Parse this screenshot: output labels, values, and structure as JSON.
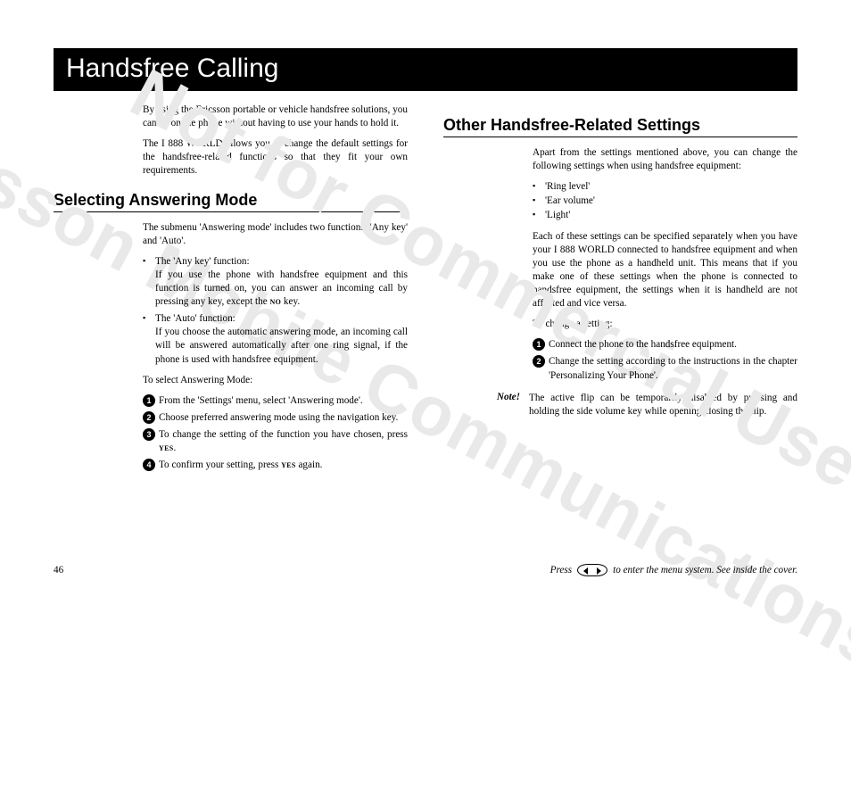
{
  "watermark": {
    "line1": "Not for Commercial Use",
    "line2": "Ericsson Mobile Communications AB"
  },
  "title": "Handsfree Calling",
  "left": {
    "intro1": "By using the Ericsson portable or vehicle handsfree solutions, you can be on the phone without having to use your hands to hold it.",
    "intro2": "The I 888 WORLD allows you to change the default settings for the handsfree-related functions so that they fit your own requirements.",
    "h2": "Selecting Answering Mode",
    "p1": "The submenu 'Answering mode' includes two functions:  'Any key' and 'Auto'.",
    "bul1a": "The 'Any key' function:",
    "bul1b_pre": "If you use the phone with handsfree equipment and this function is turned on, you can answer an incoming call by pressing any key, except the ",
    "bul1b_key": "no",
    "bul1b_post": " key.",
    "bul2a": "The 'Auto' function:",
    "bul2b": "If you choose the automatic answering mode, an incoming call will be answered automatically after one ring signal, if the phone is used with handsfree equipment.",
    "p2": "To select Answering Mode:",
    "step1": "From the 'Settings' menu, select 'Answering mode'.",
    "step2": "Choose preferred answering mode using the navigation key.",
    "step3_pre": "To change the setting of the function you have chosen, press ",
    "step3_key": "yes",
    "step3_post": ".",
    "step4_pre": "To confirm your setting, press ",
    "step4_key": "yes",
    "step4_post": " again."
  },
  "right": {
    "h2": "Other Handsfree-Related Settings",
    "p1": "Apart from the settings mentioned above, you can change the following settings when using handsfree equipment:",
    "items": {
      "a": "'Ring level'",
      "b": "'Ear volume'",
      "c": "'Light'"
    },
    "p2": "Each of these settings can be specified separately when you have your I 888 WORLD connected to handsfree equipment and when you use the phone as a handheld unit. This means that if you make one of these settings when the phone is connected to handsfree equipment, the settings when it is handheld are not affected and vice versa.",
    "p3": "To change a setting:",
    "step1": "Connect the phone to the handsfree equipment.",
    "step2": "Change the setting according to the instructions in the chapter 'Personalizing Your Phone'.",
    "note_label": "Note!",
    "note_body": "The  active flip can be temporarily disabled by pressing and holding the side volume key while opening/closing the flip."
  },
  "footer": {
    "page": "46",
    "hint_pre": "Press",
    "hint_post": "to enter the menu system. See inside the cover."
  }
}
